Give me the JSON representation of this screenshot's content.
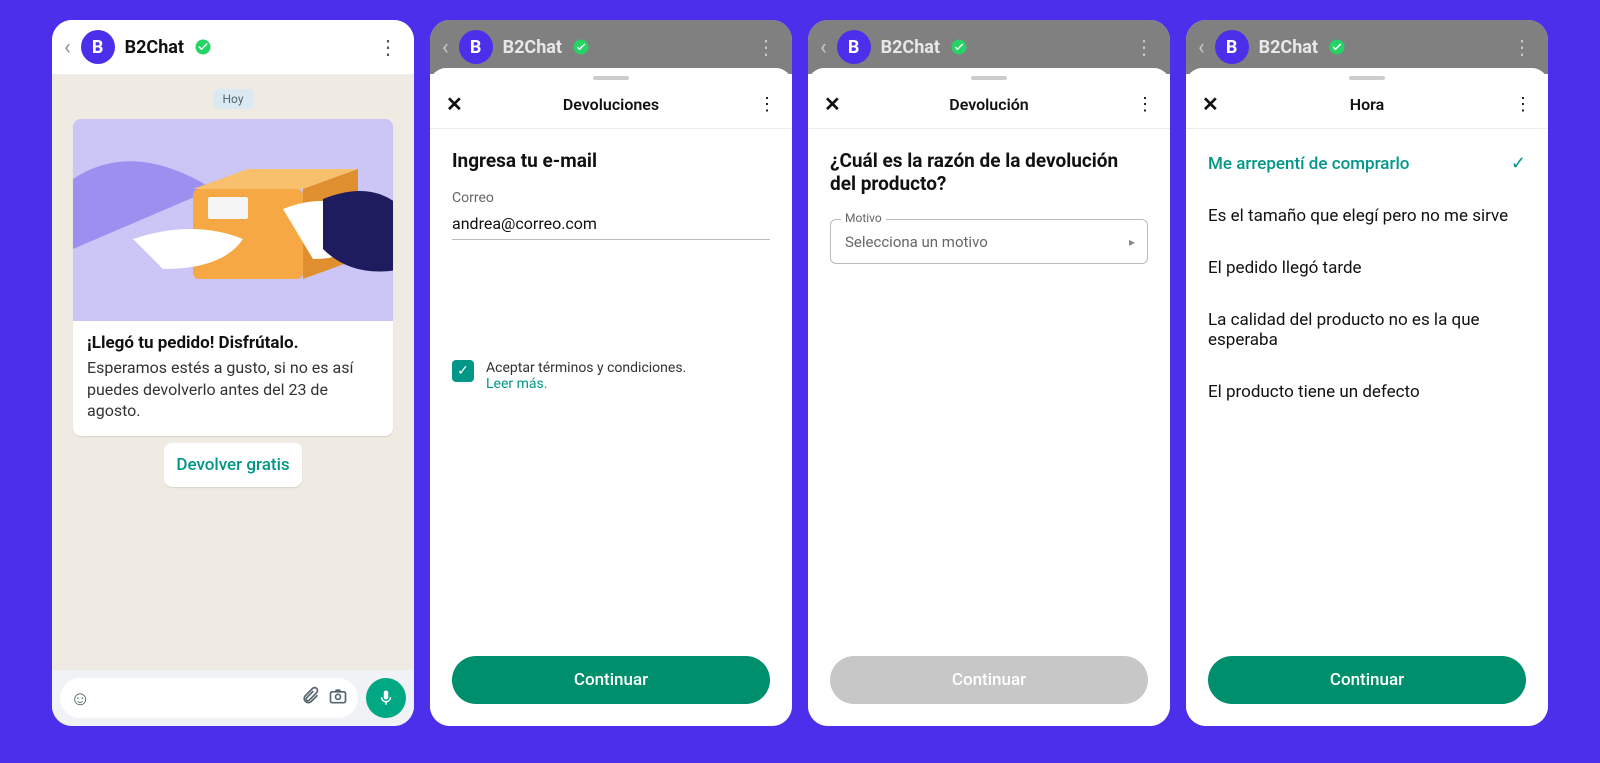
{
  "common": {
    "app_name": "B2Chat",
    "avatar_letter": "B"
  },
  "phone1": {
    "date_label": "Hoy",
    "msg_title": "¡Llegó tu pedido! Disfrútalo.",
    "msg_body": "Esperamos estés a gusto, si no es así puedes devolverlo antes del 23 de agosto.",
    "action_label": "Devolver gratis"
  },
  "phone2": {
    "sheet_title": "Devoluciones",
    "heading": "Ingresa tu e-mail",
    "field_label": "Correo",
    "field_value": "andrea@correo.com",
    "terms_text": "Aceptar términos y condiciones.",
    "terms_link": "Leer más.",
    "continue_label": "Continuar"
  },
  "phone3": {
    "sheet_title": "Devolución",
    "heading": "¿Cuál es la razón de la devolución del producto?",
    "select_legend": "Motivo",
    "select_placeholder": "Selecciona un motivo",
    "continue_label": "Continuar"
  },
  "phone4": {
    "sheet_title": "Hora",
    "options": [
      "Me arrepentí de comprarlo",
      "Es el tamaño que elegí pero no me sirve",
      "El pedido llegó tarde",
      "La calidad del producto no es la que esperaba",
      "El producto tiene un defecto"
    ],
    "continue_label": "Continuar"
  }
}
